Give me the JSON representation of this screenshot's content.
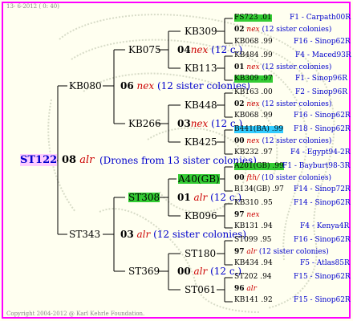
{
  "date_line": "13-  6-2012  ( 0: 40)",
  "copyright": "Copyright 2004-2012 @ Karl Kehrle Foundation.",
  "root": {
    "id": "ST122",
    "gen": "08",
    "mark": "alr",
    "note": "(Drones from 13 sister colonies)"
  },
  "father": {
    "id": "KB080",
    "gen": "06",
    "mark": "nex",
    "note": "(12 sister colonies)"
  },
  "mother": {
    "id": "ST343",
    "gen": "03",
    "mark": "alr",
    "note": "(12 sister colonies)"
  },
  "ff": {
    "id": "KB075",
    "gen": "04",
    "mark": "nex",
    "note": "(12 c.)"
  },
  "fm": {
    "id": "KB266",
    "gen": "03",
    "mark": "nex",
    "note": "(12 c.)"
  },
  "mf": {
    "id": "ST308",
    "gen": "01",
    "mark": "alr",
    "note": "(12 c.)"
  },
  "mm": {
    "id": "ST369",
    "gen": "00",
    "mark": "alr",
    "note": "(12 c.)"
  },
  "g3": [
    {
      "id": "KB309"
    },
    {
      "id": "KB113"
    },
    {
      "id": "KB448"
    },
    {
      "id": "KB425"
    },
    {
      "id": "A40(GB)"
    },
    {
      "id": "KB096"
    },
    {
      "id": "ST180"
    },
    {
      "id": "ST061"
    }
  ],
  "g4": [
    {
      "id": "FS723 .01",
      "origin": "F1 - Carpath00R"
    },
    {
      "gen": "02",
      "mark": "nex",
      "note": "(12 sister colonies)"
    },
    {
      "id": "KB068 .99",
      "origin": "F16 - Sinop62R"
    },
    {
      "id": "KB484 .99",
      "origin": "F4 - Maced93R"
    },
    {
      "gen": "01",
      "mark": "nex",
      "note": "(12 sister colonies)"
    },
    {
      "id": "KB309 .97",
      "origin": "F1 - Sinop96R"
    },
    {
      "id": "KB163 .00",
      "origin": "F2 - Sinop96R"
    },
    {
      "gen": "02",
      "mark": "nex",
      "note": "(12 sister colonies)"
    },
    {
      "id": "KB068 .99",
      "origin": "F16 - Sinop62R"
    },
    {
      "id": "B441(BA) .99",
      "origin": "F18 - Sinop62R"
    },
    {
      "gen": "00",
      "mark": "nex",
      "note": "(12 sister colonies)"
    },
    {
      "id": "KB232 .97",
      "origin": "F4 - Egypt94-2R"
    },
    {
      "id": "A201(GB) .99",
      "origin": "F1 - Bayburt98-3R"
    },
    {
      "gen": "00",
      "mark": "fth/",
      "note": "(10 sister colonies)"
    },
    {
      "id": "B134(GB) .97",
      "origin": "F14 - Sinop72R"
    },
    {
      "id": "KB310 .95",
      "origin": "F14 - Sinop62R"
    },
    {
      "gen": "97",
      "mark": "nex",
      "note": ""
    },
    {
      "id": "KB131 .94",
      "origin": "F4 - Kenya4R"
    },
    {
      "id": "ST099 .95",
      "origin": "F16 - Sinop62R"
    },
    {
      "gen": "97",
      "mark": "alr",
      "note": "(12 sister colonies)"
    },
    {
      "id": "KB434 .94",
      "origin": "F5 - Atlas85R"
    },
    {
      "id": "ST202 .94",
      "origin": "F15 - Sinop62R"
    },
    {
      "gen": "96",
      "mark": "alr",
      "note": ""
    },
    {
      "id": "KB141 .92",
      "origin": "F15 - Sinop62R"
    }
  ]
}
